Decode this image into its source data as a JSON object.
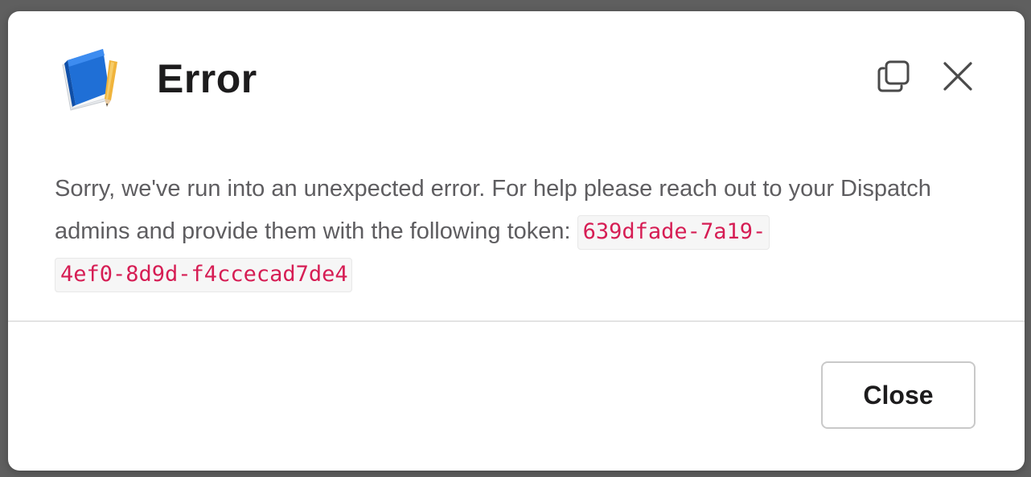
{
  "dialog": {
    "title": "Error",
    "app_icon": "notebook-pencil-icon",
    "header_actions": [
      {
        "icon": "copy-icon"
      },
      {
        "icon": "close-icon"
      }
    ],
    "message_text": "Sorry, we've run into an unexpected error. For help please reach out to your Dispatch admins and provide them with the following token: ",
    "token_part1": "639dfade-7a19-",
    "token_part2": "4ef0-8d9d-f4ccecad7de4",
    "close_button_label": "Close"
  },
  "colors": {
    "token_text": "#d61d54",
    "title_text": "#1d1c1d",
    "body_text": "#5e5d60"
  }
}
